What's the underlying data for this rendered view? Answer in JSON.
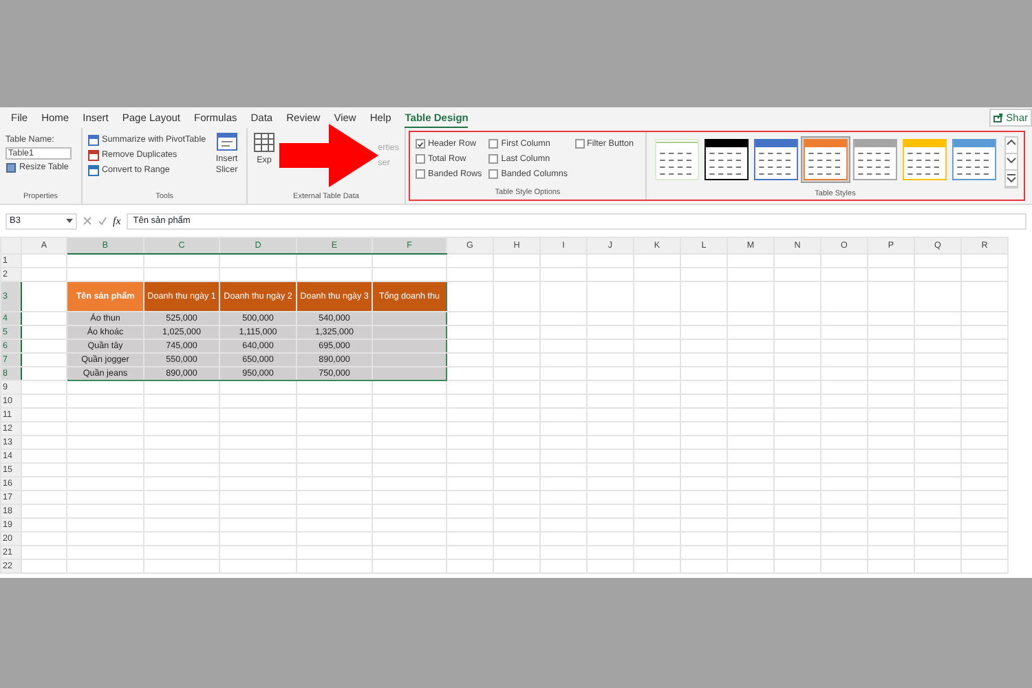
{
  "tabs": [
    {
      "label": "File",
      "selected": false
    },
    {
      "label": "Home",
      "selected": false
    },
    {
      "label": "Insert",
      "selected": false
    },
    {
      "label": "Page Layout",
      "selected": false
    },
    {
      "label": "Formulas",
      "selected": false
    },
    {
      "label": "Data",
      "selected": false
    },
    {
      "label": "Review",
      "selected": false
    },
    {
      "label": "View",
      "selected": false
    },
    {
      "label": "Help",
      "selected": false
    },
    {
      "label": "Table Design",
      "selected": true
    }
  ],
  "share": "Shar",
  "ribbon": {
    "properties": {
      "name_label": "Table Name:",
      "table_name": "Table1",
      "resize": "Resize Table",
      "group": "Properties"
    },
    "tools": {
      "items": [
        "Summarize with PivotTable",
        "Remove Duplicates",
        "Convert to Range"
      ],
      "slicer": "Insert Slicer",
      "group": "Tools"
    },
    "external": {
      "export": "Exp",
      "properties": "erties",
      "browser": "ser",
      "group": "External Table Data"
    },
    "style_options": {
      "options": [
        {
          "label": "Header Row",
          "checked": true
        },
        {
          "label": "Total Row",
          "checked": false
        },
        {
          "label": "Banded Rows",
          "checked": false
        },
        {
          "label": "First Column",
          "checked": false
        },
        {
          "label": "Last Column",
          "checked": false
        },
        {
          "label": "Banded Columns",
          "checked": false
        },
        {
          "label": "Filter Button",
          "checked": false
        }
      ],
      "group": "Table Style Options"
    },
    "table_styles": {
      "styles": [
        {
          "color": "#a9d08e",
          "selected": false
        },
        {
          "color": "#000000",
          "selected": false
        },
        {
          "color": "#4472c4",
          "selected": false
        },
        {
          "color": "#ed7d31",
          "selected": true
        },
        {
          "color": "#a5a5a5",
          "selected": false
        },
        {
          "color": "#ffc000",
          "selected": false
        },
        {
          "color": "#5b9bd5",
          "selected": false
        }
      ],
      "group": "Table Styles"
    }
  },
  "formula_bar": {
    "name_box": "B3",
    "fx": "fx",
    "value": "Tên sản phẩm"
  },
  "sheet": {
    "columns": [
      {
        "label": "A",
        "selected": false
      },
      {
        "label": "B",
        "selected": true
      },
      {
        "label": "C",
        "selected": true
      },
      {
        "label": "D",
        "selected": true
      },
      {
        "label": "E",
        "selected": true
      },
      {
        "label": "F",
        "selected": true
      },
      {
        "label": "G",
        "selected": false
      },
      {
        "label": "H",
        "selected": false
      },
      {
        "label": "I",
        "selected": false
      },
      {
        "label": "J",
        "selected": false
      },
      {
        "label": "K",
        "selected": false
      },
      {
        "label": "L",
        "selected": false
      },
      {
        "label": "M",
        "selected": false
      },
      {
        "label": "N",
        "selected": false
      },
      {
        "label": "O",
        "selected": false
      },
      {
        "label": "P",
        "selected": false
      },
      {
        "label": "Q",
        "selected": false
      },
      {
        "label": "R",
        "selected": false
      }
    ],
    "rows": [
      {
        "label": "1",
        "selected": false
      },
      {
        "label": "2",
        "selected": false
      },
      {
        "label": "3",
        "selected": true
      },
      {
        "label": "4",
        "selected": true
      },
      {
        "label": "5",
        "selected": true
      },
      {
        "label": "6",
        "selected": true
      },
      {
        "label": "7",
        "selected": true
      },
      {
        "label": "8",
        "selected": true
      },
      {
        "label": "9",
        "selected": false
      },
      {
        "label": "10",
        "selected": false
      },
      {
        "label": "11",
        "selected": false
      },
      {
        "label": "12",
        "selected": false
      },
      {
        "label": "13",
        "selected": false
      },
      {
        "label": "14",
        "selected": false
      },
      {
        "label": "15",
        "selected": false
      },
      {
        "label": "16",
        "selected": false
      },
      {
        "label": "17",
        "selected": false
      },
      {
        "label": "18",
        "selected": false
      },
      {
        "label": "19",
        "selected": false
      },
      {
        "label": "20",
        "selected": false
      },
      {
        "label": "21",
        "selected": false
      },
      {
        "label": "22",
        "selected": false
      }
    ],
    "table": {
      "header": [
        {
          "text": "Tên sản phẩm",
          "active": true
        },
        {
          "text": "Doanh thu ngày 1",
          "active": false
        },
        {
          "text": "Doanh thu ngày 2",
          "active": false
        },
        {
          "text": "Doanh thu ngày 3",
          "active": false
        },
        {
          "text": "Tổng doanh thu",
          "active": false
        }
      ],
      "rows": [
        [
          "Áo thun",
          "525,000",
          "500,000",
          "540,000"
        ],
        [
          "Áo khoác",
          "1,025,000",
          "1,115,000",
          "1,325,000"
        ],
        [
          "Quần tây",
          "745,000",
          "640,000",
          "695,000"
        ],
        [
          "Quần jogger",
          "550,000",
          "650,000",
          "890,000"
        ],
        [
          "Quần jeans",
          "890,000",
          "950,000",
          "750,000"
        ]
      ]
    }
  }
}
